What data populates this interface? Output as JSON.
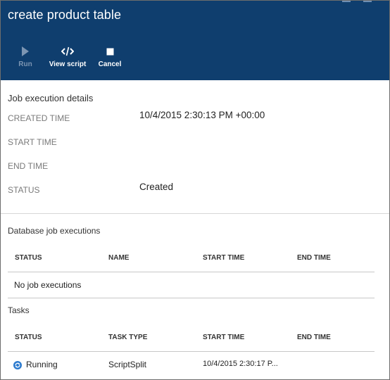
{
  "window": {
    "title": "create product table"
  },
  "toolbar": {
    "run_label": "Run",
    "view_script_label": "View script",
    "cancel_label": "Cancel"
  },
  "job_details": {
    "section_title": "Job execution details",
    "created_time_label": "CREATED TIME",
    "created_time_value": "10/4/2015 2:30:13 PM +00:00",
    "start_time_label": "START TIME",
    "end_time_label": "END TIME",
    "status_label": "STATUS",
    "status_value": "Created"
  },
  "db_executions": {
    "section_title": "Database job executions",
    "columns": [
      "STATUS",
      "NAME",
      "START TIME",
      "END TIME"
    ],
    "empty_message": "No job executions"
  },
  "tasks": {
    "section_title": "Tasks",
    "columns": [
      "STATUS",
      "TASK TYPE",
      "START TIME",
      "END TIME"
    ],
    "rows": [
      {
        "status": "Running",
        "task_type": "ScriptSplit",
        "start_time": "10/4/2015 2:30:17 P...",
        "end_time": ""
      }
    ]
  },
  "colors": {
    "header_bg": "#0f3e6e",
    "running_icon": "#2e7ccf"
  }
}
